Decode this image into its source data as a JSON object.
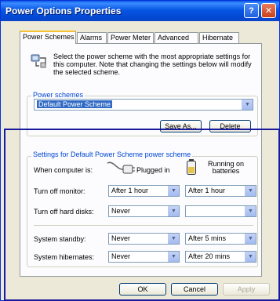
{
  "window": {
    "title": "Power Options Properties"
  },
  "tabs": [
    "Power Schemes",
    "Alarms",
    "Power Meter",
    "Advanced",
    "Hibernate"
  ],
  "description": "Select the power scheme with the most appropriate settings for this computer. Note that changing the settings below will modify the selected scheme.",
  "schemes": {
    "label": "Power schemes",
    "selected": "Default Power Scheme",
    "save_as": "Save As...",
    "delete": "Delete"
  },
  "settings": {
    "label": "Settings for Default Power Scheme power scheme",
    "when_computer_is": "When computer is:",
    "plugged_in": "Plugged in",
    "running_on_batteries": "Running on batteries",
    "rows": [
      {
        "label": "Turn off monitor:",
        "plugged": "After 1 hour",
        "battery": "After 1 hour"
      },
      {
        "label": "Turn off hard disks:",
        "plugged": "Never",
        "battery": ""
      },
      {
        "label": "System standby:",
        "plugged": "Never",
        "battery": "After 5 mins"
      },
      {
        "label": "System hibernates:",
        "plugged": "Never",
        "battery": "After 20 mins"
      }
    ]
  },
  "footer": {
    "ok": "OK",
    "cancel": "Cancel",
    "apply": "Apply"
  }
}
